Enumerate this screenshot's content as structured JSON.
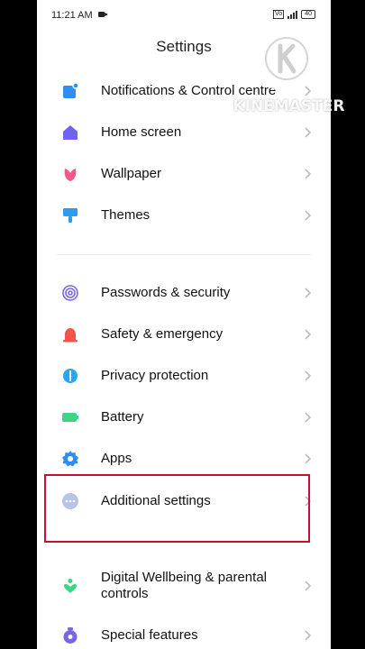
{
  "status_bar": {
    "time": "11:21 AM",
    "battery": "40",
    "sim_label": "Vo"
  },
  "page": {
    "title": "Settings"
  },
  "items": [
    {
      "label": "Notifications & Control centre",
      "icon": "notifications-icon",
      "color": "#2e8ff2"
    },
    {
      "label": "Home screen",
      "icon": "home-icon",
      "color": "#6f63f5"
    },
    {
      "label": "Wallpaper",
      "icon": "wallpaper-icon",
      "color": "#f0598c"
    },
    {
      "label": "Themes",
      "icon": "themes-icon",
      "color": "#2e9bf0"
    },
    {
      "label": "Passwords & security",
      "icon": "fingerprint-icon",
      "color": "#7a66e0"
    },
    {
      "label": "Safety & emergency",
      "icon": "alarm-icon",
      "color": "#f2554a"
    },
    {
      "label": "Privacy protection",
      "icon": "privacy-icon",
      "color": "#27a8ee"
    },
    {
      "label": "Battery",
      "icon": "battery-icon",
      "color": "#3ad587"
    },
    {
      "label": "Apps",
      "icon": "gear-icon",
      "color": "#2e8ff2"
    },
    {
      "label": "Additional settings",
      "icon": "more-dots-icon",
      "color": "#b8c3e8"
    },
    {
      "label": "Digital Wellbeing & parental controls",
      "icon": "wellbeing-icon",
      "color": "#3ad587"
    },
    {
      "label": "Special features",
      "icon": "special-features-icon",
      "color": "#7a66e0"
    }
  ],
  "watermark": {
    "text": "KINEMASTER"
  },
  "colors": {
    "highlight_border": "#c8102e",
    "chevron": "#bdbdbd"
  }
}
